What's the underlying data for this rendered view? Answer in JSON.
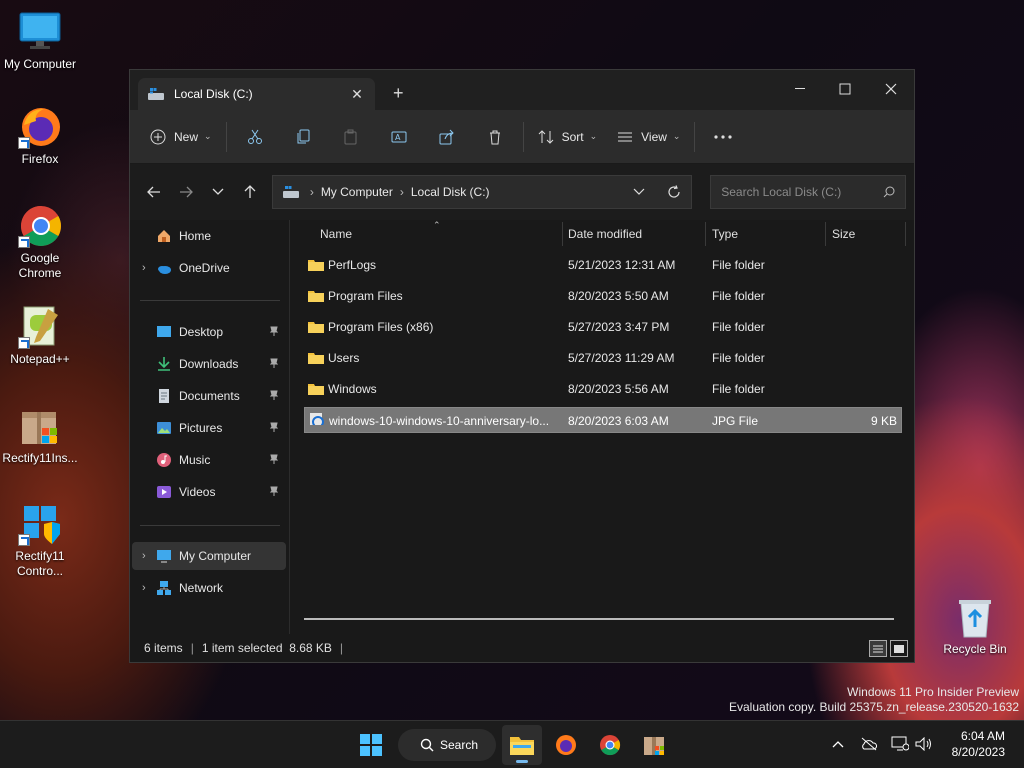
{
  "desktop": {
    "icons": [
      {
        "label": "My Computer"
      },
      {
        "label": "Firefox"
      },
      {
        "label": "Google Chrome"
      },
      {
        "label": "Notepad++"
      },
      {
        "label": "Rectify11Ins..."
      },
      {
        "label": "Rectify11 Contro..."
      },
      {
        "label": "Recycle Bin"
      }
    ],
    "watermark_line1": "Windows 11 Pro Insider Preview",
    "watermark_line2": "Evaluation copy. Build 25375.zn_release.230520-1632"
  },
  "window": {
    "tab_title": "Local Disk (C:)",
    "toolbar": {
      "new_label": "New",
      "sort_label": "Sort",
      "view_label": "View"
    },
    "address": {
      "crumbs": [
        "My Computer",
        "Local Disk (C:)"
      ]
    },
    "search": {
      "placeholder": "Search Local Disk (C:)"
    },
    "nav": {
      "items": [
        {
          "label": "Home"
        },
        {
          "label": "OneDrive"
        },
        {
          "label": "Desktop"
        },
        {
          "label": "Downloads"
        },
        {
          "label": "Documents"
        },
        {
          "label": "Pictures"
        },
        {
          "label": "Music"
        },
        {
          "label": "Videos"
        },
        {
          "label": "My Computer"
        },
        {
          "label": "Network"
        }
      ]
    },
    "columns": [
      "Name",
      "Date modified",
      "Type",
      "Size"
    ],
    "files": [
      {
        "name": "PerfLogs",
        "date": "5/21/2023 12:31 AM",
        "type": "File folder",
        "size": ""
      },
      {
        "name": "Program Files",
        "date": "8/20/2023 5:50 AM",
        "type": "File folder",
        "size": ""
      },
      {
        "name": "Program Files (x86)",
        "date": "5/27/2023 3:47 PM",
        "type": "File folder",
        "size": ""
      },
      {
        "name": "Users",
        "date": "5/27/2023 11:29 AM",
        "type": "File folder",
        "size": ""
      },
      {
        "name": "Windows",
        "date": "8/20/2023 5:56 AM",
        "type": "File folder",
        "size": ""
      },
      {
        "name": "windows-10-windows-10-anniversary-lo...",
        "date": "8/20/2023 6:03 AM",
        "type": "JPG File",
        "size": "9 KB"
      }
    ],
    "status": {
      "items_count": "6 items",
      "selection": "1 item selected  8.68 KB"
    }
  },
  "taskbar": {
    "search_label": "Search",
    "time": "6:04 AM",
    "date": "8/20/2023"
  },
  "colors": {
    "accent": "#76b9ed",
    "folder": "#f3c13a"
  }
}
